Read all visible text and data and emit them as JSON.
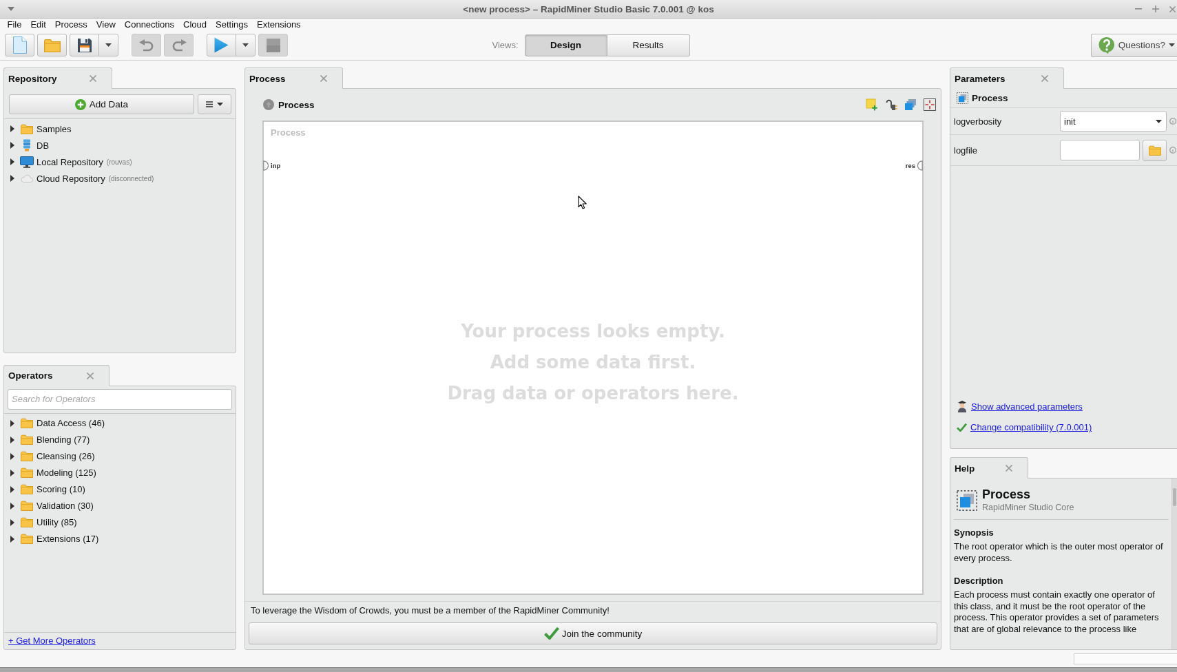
{
  "window": {
    "title": "<new process> – RapidMiner Studio Basic 7.0.001 @ kos"
  },
  "menu": [
    "File",
    "Edit",
    "Process",
    "View",
    "Connections",
    "Cloud",
    "Settings",
    "Extensions"
  ],
  "toolbar": {
    "groups": [
      {
        "buttons": [
          {
            "kind": "new",
            "disabled": false,
            "dropdown": false
          },
          {
            "kind": "open",
            "disabled": false,
            "dropdown": false
          },
          {
            "kind": "save",
            "disabled": false,
            "dropdown": true
          }
        ]
      },
      {
        "buttons": [
          {
            "kind": "undo",
            "disabled": true,
            "dropdown": false
          },
          {
            "kind": "redo",
            "disabled": true,
            "dropdown": false
          }
        ]
      },
      {
        "buttons": [
          {
            "kind": "run",
            "disabled": false,
            "dropdown": true
          },
          {
            "kind": "stop",
            "disabled": true,
            "dropdown": false
          }
        ]
      }
    ],
    "views": {
      "label": "Views:",
      "options": [
        {
          "label": "Design",
          "selected": true
        },
        {
          "label": "Results",
          "selected": false
        }
      ]
    },
    "help_menu": {
      "label": "Questions?"
    }
  },
  "repository": {
    "title": "Repository",
    "add_button": "Add Data",
    "items": [
      {
        "kind": "folder",
        "label": "Samples",
        "expanded": false
      },
      {
        "kind": "database",
        "label": "DB",
        "expanded": false
      },
      {
        "kind": "local",
        "label": "Local Repository",
        "note": "(rouvas)",
        "expanded": false
      },
      {
        "kind": "cloud",
        "label": "Cloud Repository",
        "note": "(disconnected)",
        "expanded": false
      }
    ]
  },
  "operators": {
    "title": "Operators",
    "search": {
      "placeholder": "Search for Operators"
    },
    "groups": [
      {
        "label": "Data Access (46)",
        "expanded": false
      },
      {
        "label": "Blending (77)",
        "expanded": false
      },
      {
        "label": "Cleansing (26)",
        "expanded": false
      },
      {
        "label": "Modeling (125)",
        "expanded": false
      },
      {
        "label": "Scoring (10)",
        "expanded": false
      },
      {
        "label": "Validation (30)",
        "expanded": false
      },
      {
        "label": "Utility (85)",
        "expanded": false
      },
      {
        "label": "Extensions (17)",
        "expanded": false
      }
    ],
    "more_link": "+ Get More Operators"
  },
  "process": {
    "tab": "Process",
    "header": "Process",
    "canvas": {
      "title": "Process",
      "ports": [
        {
          "kind": "input",
          "label": "inp"
        },
        {
          "kind": "output",
          "label": "res"
        }
      ],
      "empty_message": [
        "Your process looks empty.",
        "Add some data first.",
        "Drag data or operators here."
      ]
    },
    "community": {
      "message": "To leverage the Wisdom of Crowds, you must be a member of the RapidMiner Community!",
      "button": "Join the community"
    }
  },
  "parameters": {
    "title": "Parameters",
    "operator": "Process",
    "params": [
      {
        "name": "logverbosity",
        "kind": "select",
        "value": "init"
      },
      {
        "name": "logfile",
        "kind": "file"
      }
    ],
    "links": [
      {
        "kind": "advanced",
        "label": "Show advanced parameters"
      },
      {
        "kind": "compatibility",
        "label": "Change compatibility (7.0.001)"
      }
    ]
  },
  "help": {
    "title": "Help",
    "operator": "Process",
    "source": "RapidMiner Studio Core",
    "sections": [
      {
        "heading": "Synopsis",
        "text": "The root operator which is the outer most operator of every process."
      },
      {
        "heading": "Description",
        "text": "Each process must contain exactly one operator of this class, and it must be the root operator of the process. This operator provides a set of parameters that are of global relevance to the process like"
      }
    ]
  }
}
